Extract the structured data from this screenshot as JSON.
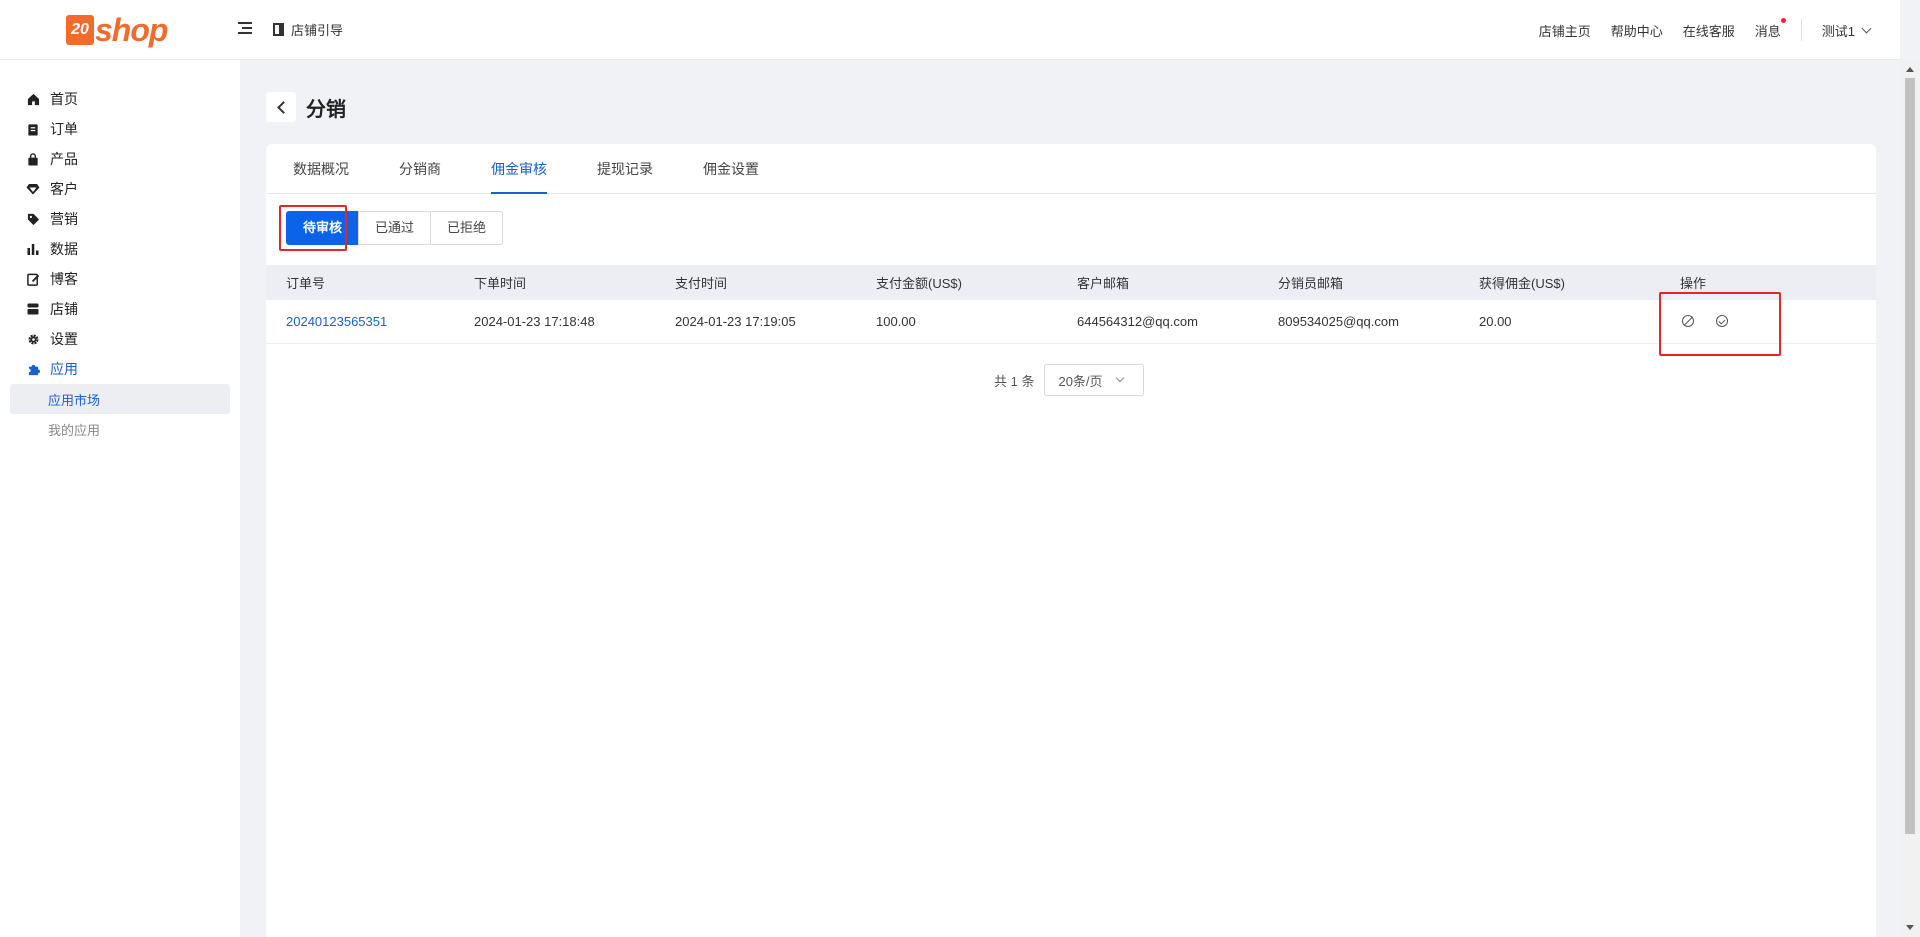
{
  "header": {
    "logo_mark": "20",
    "logo_text": "shop",
    "guide": "店铺引导",
    "links": [
      "店铺主页",
      "帮助中心",
      "在线客服",
      "消息"
    ],
    "user": "测试1"
  },
  "sidebar": {
    "items": [
      {
        "label": "首页",
        "icon": "home-icon"
      },
      {
        "label": "订单",
        "icon": "order-icon"
      },
      {
        "label": "产品",
        "icon": "bag-icon"
      },
      {
        "label": "客户",
        "icon": "diamond-icon"
      },
      {
        "label": "营销",
        "icon": "tag-icon"
      },
      {
        "label": "数据",
        "icon": "bar-chart-icon"
      },
      {
        "label": "博客",
        "icon": "edit-icon"
      },
      {
        "label": "店铺",
        "icon": "store-icon"
      },
      {
        "label": "设置",
        "icon": "gear-icon"
      },
      {
        "label": "应用",
        "icon": "puzzle-icon"
      }
    ],
    "sub_items": [
      "应用市场",
      "我的应用"
    ]
  },
  "page": {
    "title": "分销"
  },
  "tabs": [
    "数据概况",
    "分销商",
    "佣金审核",
    "提现记录",
    "佣金设置"
  ],
  "status_filter": [
    "待审核",
    "已通过",
    "已拒绝"
  ],
  "table": {
    "columns": [
      "订单号",
      "下单时间",
      "支付时间",
      "支付金额(US$)",
      "客户邮箱",
      "分销员邮箱",
      "获得佣金(US$)",
      "操作"
    ],
    "rows": [
      {
        "order_no": "20240123565351",
        "order_time": "2024-01-23 17:18:48",
        "pay_time": "2024-01-23 17:19:05",
        "amount": "100.00",
        "customer_email": "644564312@qq.com",
        "distributor_email": "809534025@qq.com",
        "commission": "20.00"
      }
    ]
  },
  "pagination": {
    "total": "共 1 条",
    "page_size": "20条/页"
  },
  "colors": {
    "primary": "#0a63e8",
    "link": "#1a5fcf",
    "brand": "#f26b2b",
    "highlight": "#e5252a"
  }
}
